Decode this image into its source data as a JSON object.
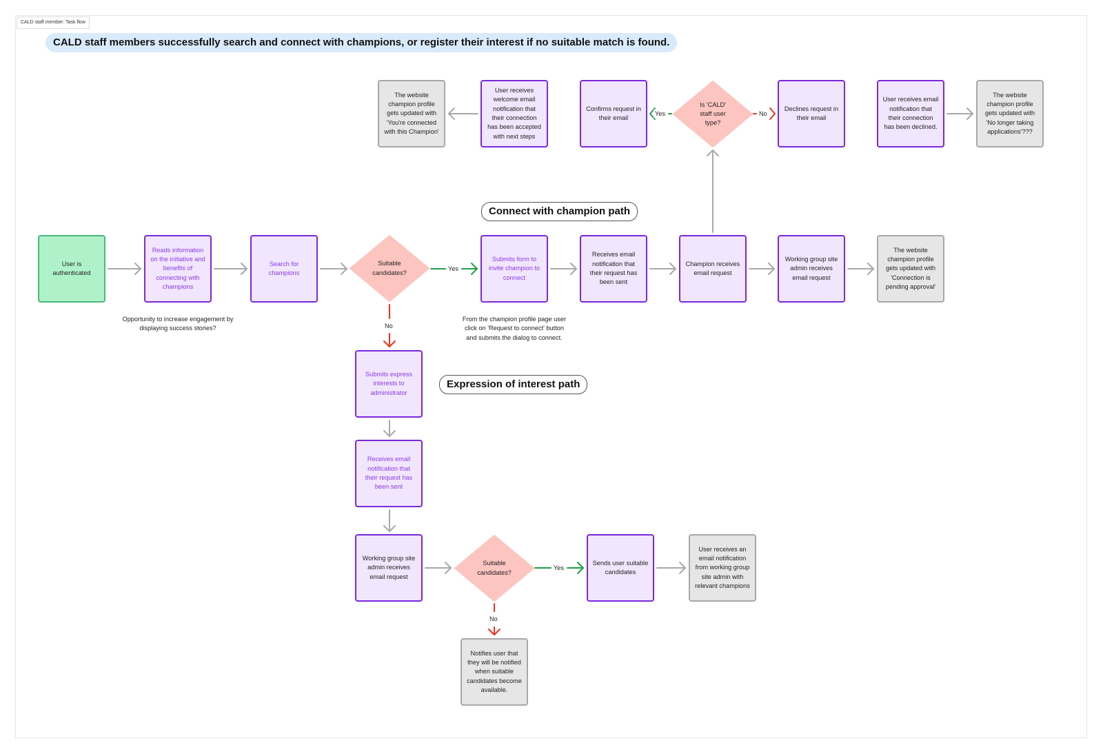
{
  "frame": {
    "label": "CALD staff member: Task flow"
  },
  "title": "CALD staff members successfully search and connect with champions, or register their interest if no suitable match is found.",
  "path_labels": {
    "connect": "Connect with champion path",
    "expression": "Expression of interest path"
  },
  "colors": {
    "purple_border": "#7a28dc",
    "purple_fill": "#f1e6fd",
    "purple_accent_text": "#8a3ae6",
    "gray_border": "#a8a8a8",
    "gray_fill": "#e6e6e6",
    "green_border": "#4cb679",
    "green_fill": "#aff2c9",
    "decision_fill": "#fdc5c0",
    "arrow_gray": "#a8a8a8",
    "arrow_yes": "#1aa04a",
    "arrow_no": "#f0301a",
    "title_pill": "#d9eafb"
  },
  "nodes": {
    "user_authenticated": "User is authenticated",
    "reads_information": "Reads information on the initiative and benefits of connecting with champions",
    "search_champions": "Search for champions",
    "suitable_candidates_1": "Suitable candidates?",
    "submits_form": "Submits form to invite champion to connect",
    "receives_email_sent": "Receives email notification that their request has been sent",
    "champion_receives": "Champion receives email request",
    "admin_receives_1": "Working group site admin receives email request",
    "profile_pending": "The website champion profile gets updated with 'Connection is pending approval'",
    "is_cald_staff": "Is 'CALD' staff user type?",
    "confirms_request": "Confirms request in their email",
    "welcome_email": "User receives welcome email notification that their connection has been accepted with next steps",
    "profile_connected": "The website champion profile gets updated with 'You're connected with this Champion'",
    "declines_request": "Declines request in their email",
    "declined_email": "User receives email notification that their connection has been declined.",
    "profile_no_longer": "The website champion profile gets updated with 'No longer taking applications'???",
    "submits_express_interest": "Submits express interests to administrator",
    "receives_email_sent_2": "Receives email notification that their request has been sent",
    "admin_receives_2": "Working group site admin receives email request",
    "suitable_candidates_2": "Suitable candidates?",
    "sends_candidates": "Sends user suitable candidates",
    "user_receives_relevant": "User receives an email notification from working group site admin with relevant champions",
    "notifies_user": "Notifies user that they will be notified when suitable candidates become available."
  },
  "notes": {
    "engagement": "Opportunity to increase engagement by displaying success stories?",
    "request_to_connect": "From the champion profile page user click on 'Request to connect' button and submits the dialog to connect."
  },
  "edge_labels": {
    "yes": "Yes",
    "no": "No"
  }
}
